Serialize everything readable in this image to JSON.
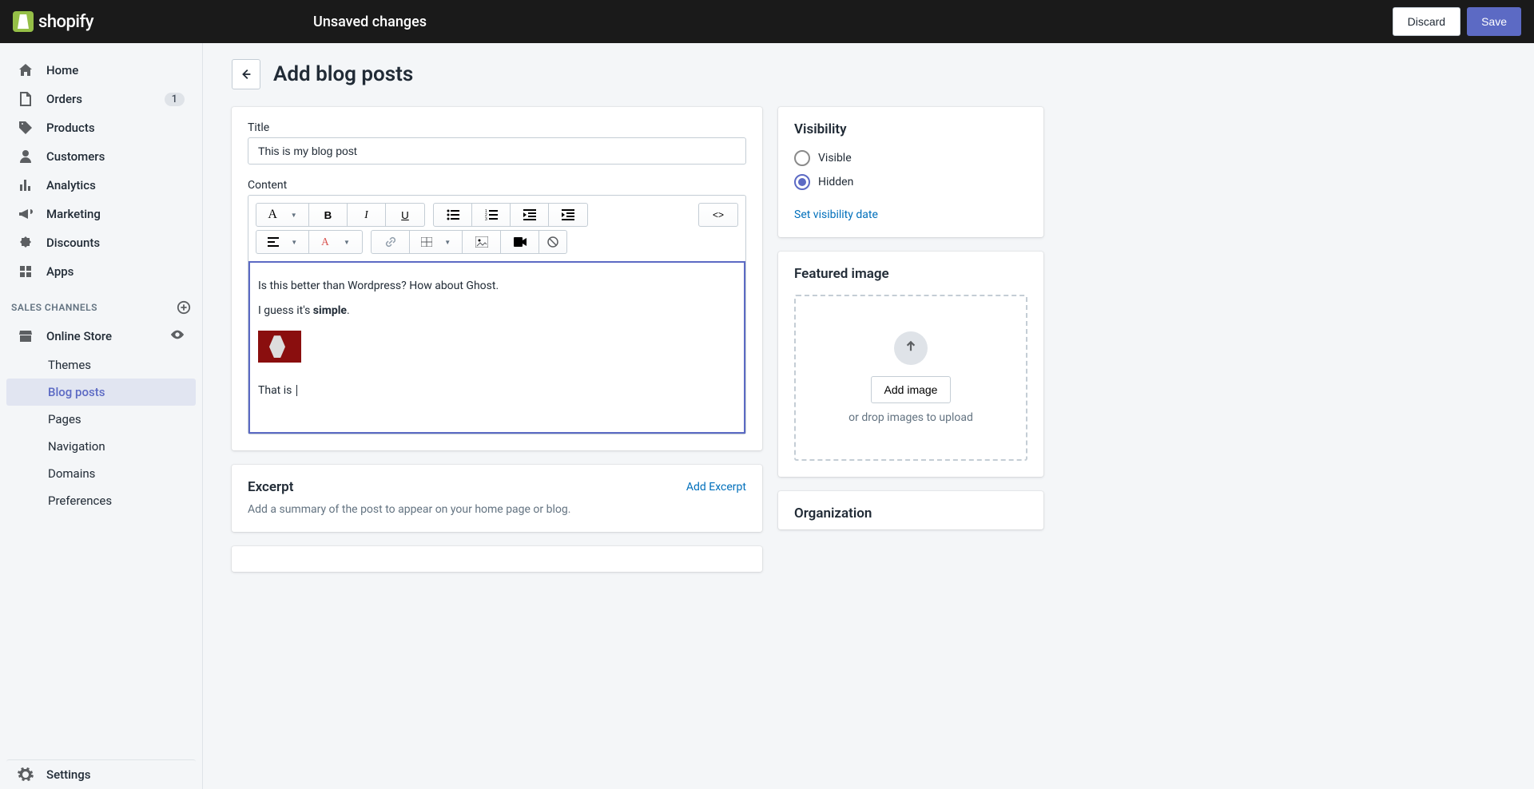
{
  "topbar": {
    "logo_text": "shopify",
    "unsaved_label": "Unsaved changes",
    "discard_label": "Discard",
    "save_label": "Save"
  },
  "sidebar": {
    "home": "Home",
    "orders": "Orders",
    "orders_badge": "1",
    "products": "Products",
    "customers": "Customers",
    "analytics": "Analytics",
    "marketing": "Marketing",
    "discounts": "Discounts",
    "apps": "Apps",
    "sales_channels": "SALES CHANNELS",
    "online_store": "Online Store",
    "sub_themes": "Themes",
    "sub_blog_posts": "Blog posts",
    "sub_pages": "Pages",
    "sub_navigation": "Navigation",
    "sub_domains": "Domains",
    "sub_preferences": "Preferences",
    "settings": "Settings"
  },
  "page": {
    "title": "Add blog posts"
  },
  "form": {
    "title_label": "Title",
    "title_value": "This is my blog post",
    "content_label": "Content",
    "content_line1": "Is this better than Wordpress? How about Ghost.",
    "content_line2_prefix": "I guess it's ",
    "content_line2_bold": "simple",
    "content_line2_suffix": ".",
    "content_line3": "That is ",
    "excerpt_heading": "Excerpt",
    "add_excerpt": "Add Excerpt",
    "excerpt_hint": "Add a summary of the post to appear on your home page or blog."
  },
  "visibility": {
    "heading": "Visibility",
    "visible": "Visible",
    "hidden": "Hidden",
    "set_date": "Set visibility date"
  },
  "featured": {
    "heading": "Featured image",
    "add_image": "Add image",
    "drop_hint": "or drop images to upload"
  },
  "organization": {
    "heading": "Organization"
  }
}
